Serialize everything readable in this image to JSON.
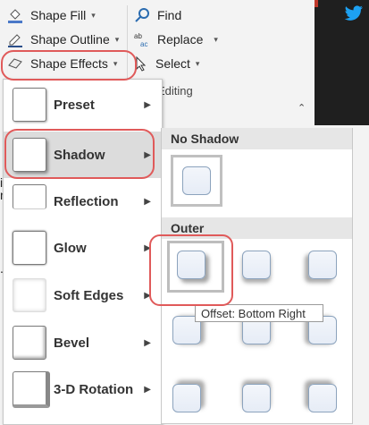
{
  "ribbon": {
    "shape_fill": "Shape Fill",
    "shape_outline": "Shape Outline",
    "shape_effects": "Shape Effects",
    "find": "Find",
    "replace": "Replace",
    "select": "Select",
    "editing_group": "Editing"
  },
  "menu": {
    "items": [
      {
        "label": "Preset"
      },
      {
        "label": "Shadow"
      },
      {
        "label": "Reflection"
      },
      {
        "label": "Glow"
      },
      {
        "label": "Soft Edges"
      },
      {
        "label": "Bevel"
      },
      {
        "label": "3-D Rotation"
      }
    ],
    "selected": "Shadow"
  },
  "gallery": {
    "no_shadow_header": "No Shadow",
    "outer_header": "Outer"
  },
  "tooltip": "Offset: Bottom Right",
  "colors": {
    "highlight": "#e05a5a",
    "selected_bg": "#dcdcdc",
    "dark_panel": "#1f1f1f",
    "twitter_blue": "#1da1f2"
  },
  "icons": {
    "twitter": "twitter-icon"
  }
}
